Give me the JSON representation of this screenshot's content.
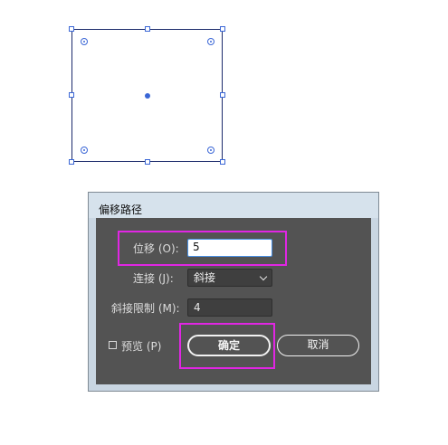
{
  "dialog": {
    "title": "偏移路径",
    "offset": {
      "label": "位移 (O):",
      "value": "5"
    },
    "joins": {
      "label": "连接 (J):",
      "selected": "斜接"
    },
    "miter_limit": {
      "label": "斜接限制 (M):",
      "value": "4"
    },
    "preview": {
      "label": "预览 (P)",
      "checked": false
    },
    "buttons": {
      "ok": "确定",
      "cancel": "取消"
    }
  },
  "colors": {
    "highlight": "#e026e3",
    "selection": "#3a66d6",
    "panel": "#535353"
  }
}
